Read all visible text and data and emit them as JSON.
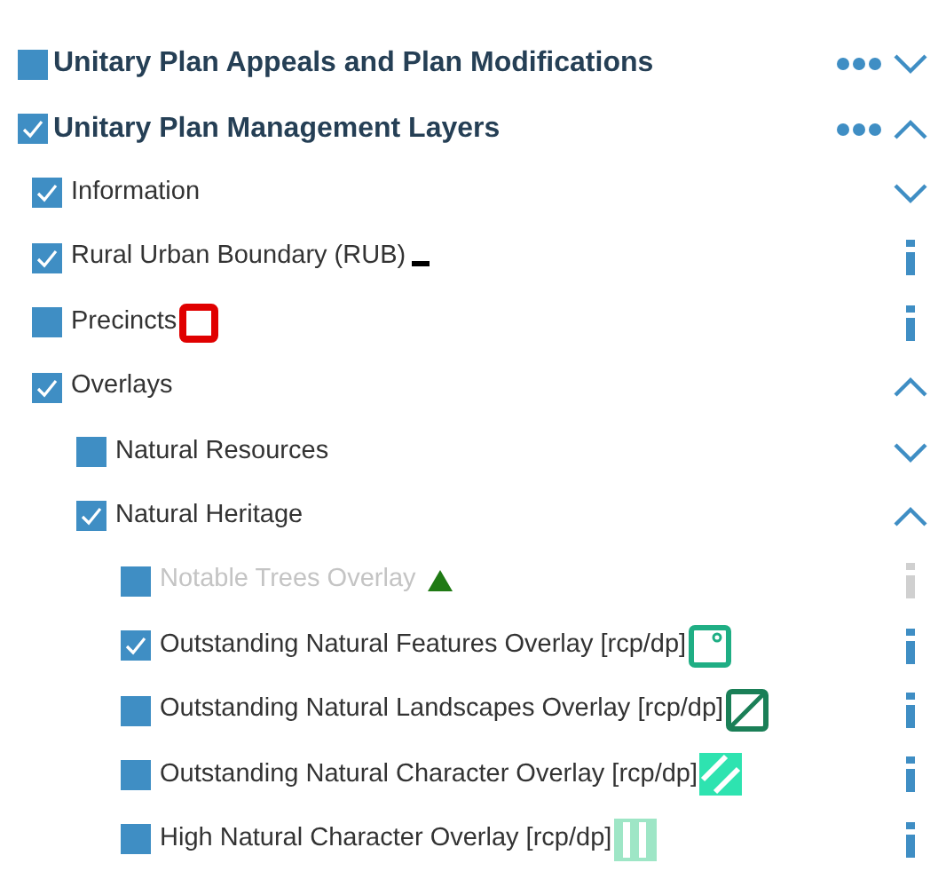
{
  "layers": [
    {
      "kind": "section",
      "label": "Unitary Plan Appeals and Plan Modifications",
      "checked": false,
      "disabled": false,
      "expanded": false
    },
    {
      "kind": "section",
      "label": "Unitary Plan Management Layers",
      "checked": true,
      "disabled": false,
      "expanded": true,
      "children": [
        {
          "kind": "group",
          "label": "Information",
          "checked": true,
          "disabled": false,
          "expanded": false
        },
        {
          "kind": "layer",
          "label": "Rural Urban Boundary (RUB)",
          "checked": true,
          "disabled": false,
          "legend": {
            "kind": "dash"
          }
        },
        {
          "kind": "layer",
          "label": "Precincts",
          "checked": false,
          "disabled": false,
          "legend": {
            "kind": "outline"
          }
        },
        {
          "kind": "group",
          "label": "Overlays",
          "checked": true,
          "disabled": false,
          "expanded": true,
          "children": [
            {
              "kind": "group",
              "label": "Natural Resources",
              "checked": false,
              "disabled": false,
              "expanded": false
            },
            {
              "kind": "group",
              "label": "Natural Heritage",
              "checked": true,
              "disabled": false,
              "expanded": true,
              "children": [
                {
                  "kind": "layer",
                  "label": "Notable Trees Overlay",
                  "checked": false,
                  "disabled": true,
                  "legend": {
                    "kind": "triangle"
                  }
                },
                {
                  "kind": "layer",
                  "label": "Outstanding Natural Features Overlay [rcp/dp]",
                  "checked": true,
                  "disabled": false,
                  "legend": {
                    "kind": "dotted"
                  }
                },
                {
                  "kind": "layer",
                  "label": "Outstanding Natural Landscapes Overlay [rcp/dp]",
                  "checked": false,
                  "disabled": false,
                  "legend": {
                    "kind": "diagonal"
                  }
                },
                {
                  "kind": "layer",
                  "label": "Outstanding Natural Character Overlay [rcp/dp]",
                  "checked": false,
                  "disabled": false,
                  "legend": {
                    "kind": "hatched"
                  }
                },
                {
                  "kind": "layer",
                  "label": "High Natural Character Overlay [rcp/dp]",
                  "checked": false,
                  "disabled": false,
                  "legend": {
                    "kind": "striped"
                  }
                }
              ]
            }
          ]
        }
      ]
    }
  ]
}
